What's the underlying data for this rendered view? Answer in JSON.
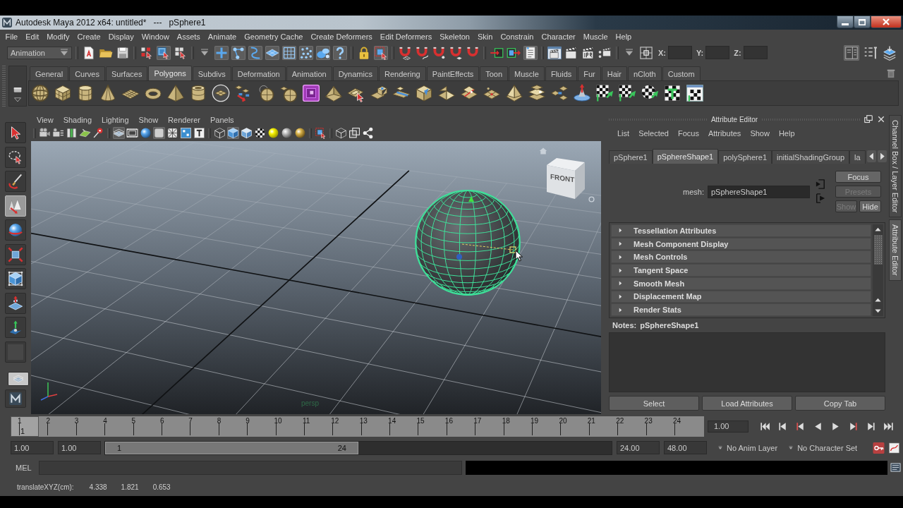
{
  "window": {
    "title": "Autodesk Maya 2012 x64: untitled*   ---   pSphere1"
  },
  "menu_bar": [
    "File",
    "Edit",
    "Modify",
    "Create",
    "Display",
    "Window",
    "Assets",
    "Animate",
    "Geometry Cache",
    "Create Deformers",
    "Edit Deformers",
    "Skeleton",
    "Skin",
    "Constrain",
    "Character",
    "Muscle",
    "Help"
  ],
  "status_line": {
    "menu_set": "Animation",
    "groups": [
      [
        {
          "kind": "new-file",
          "on": false
        },
        {
          "kind": "folder",
          "on": false
        },
        {
          "kind": "save",
          "on": false
        }
      ],
      [
        {
          "kind": "squares-cursor",
          "on": false
        },
        {
          "kind": "cube-cursor",
          "on": true
        },
        {
          "kind": "grid-cursor",
          "on": false
        }
      ],
      [
        {
          "kind": "caret",
          "on": false
        },
        {
          "kind": "plus",
          "on": true
        },
        {
          "kind": "curve-points",
          "on": true
        },
        {
          "kind": "curve",
          "on": true
        },
        {
          "kind": "plane-tile",
          "on": true
        },
        {
          "kind": "frame",
          "on": true
        },
        {
          "kind": "dots",
          "on": true
        },
        {
          "kind": "particles",
          "on": true
        },
        {
          "kind": "question-mark",
          "on": true
        }
      ],
      [
        {
          "kind": "lock",
          "on": false
        },
        {
          "kind": "select-box",
          "on": true
        }
      ],
      [
        {
          "kind": "magnet-grid",
          "on": false
        },
        {
          "kind": "magnet-curve",
          "on": false
        },
        {
          "kind": "magnet-point",
          "on": false
        },
        {
          "kind": "magnet-plane",
          "on": false
        },
        {
          "kind": "magnet",
          "on": false
        }
      ],
      [
        {
          "kind": "input-arrow",
          "on": false
        },
        {
          "kind": "output-arrow",
          "on": false
        },
        {
          "kind": "notes",
          "on": true
        }
      ],
      [
        {
          "kind": "clapper-window",
          "on": false
        },
        {
          "kind": "clapper",
          "on": false
        },
        {
          "kind": "clapper-ipr",
          "on": false
        },
        {
          "kind": "clapper-dots",
          "on": false
        }
      ],
      [
        {
          "kind": "caret",
          "on": false
        },
        {
          "kind": "target-frame",
          "on": false
        }
      ]
    ],
    "fields": [
      "X:",
      "Y:",
      "Z:"
    ],
    "panel_toggles": [
      {
        "kind": "panel",
        "on": true
      },
      {
        "kind": "list-wrench",
        "on": false
      },
      {
        "kind": "layers",
        "on": false
      }
    ]
  },
  "shelf": {
    "tabs": [
      {
        "label": "General",
        "selected": false
      },
      {
        "label": "Curves",
        "selected": false
      },
      {
        "label": "Surfaces",
        "selected": false
      },
      {
        "label": "Polygons",
        "selected": true
      },
      {
        "label": "Subdivs",
        "selected": false
      },
      {
        "label": "Deformation",
        "selected": false
      },
      {
        "label": "Animation",
        "selected": false
      },
      {
        "label": "Dynamics",
        "selected": false
      },
      {
        "label": "Rendering",
        "selected": false
      },
      {
        "label": "PaintEffects",
        "selected": false
      },
      {
        "label": "Toon",
        "selected": false
      },
      {
        "label": "Muscle",
        "selected": false
      },
      {
        "label": "Fluids",
        "selected": false
      },
      {
        "label": "Fur",
        "selected": false
      },
      {
        "label": "Hair",
        "selected": false
      },
      {
        "label": "nCloth",
        "selected": false
      },
      {
        "label": "Custom",
        "selected": false
      }
    ]
  },
  "toolbox": [
    {
      "kind": "select-arrow",
      "selected": false
    },
    {
      "kind": "lasso",
      "selected": false
    },
    {
      "kind": "paint-brush",
      "selected": false
    },
    {
      "kind": "move-tool",
      "selected": true
    },
    {
      "kind": "rotate-tool",
      "selected": false
    },
    {
      "kind": "scale-tool",
      "selected": false
    },
    {
      "kind": "universal-manip",
      "selected": false
    },
    {
      "kind": "soft-mod",
      "selected": false
    },
    {
      "kind": "show-manip",
      "selected": false
    },
    {
      "kind": "tool-slot",
      "selected": false
    }
  ],
  "viewport": {
    "menu": [
      "View",
      "Shading",
      "Lighting",
      "Show",
      "Renderer",
      "Panels"
    ],
    "toolbar": [
      [
        {
          "kind": "camera",
          "on": false
        },
        {
          "kind": "camera-reel",
          "on": false
        },
        {
          "kind": "bookmark",
          "on": false
        },
        {
          "kind": "image-plane",
          "on": false
        },
        {
          "kind": "cursor-pin",
          "on": false
        }
      ],
      [
        {
          "kind": "stacked-plane",
          "on": true
        },
        {
          "kind": "film-gate",
          "on": false
        },
        {
          "kind": "ball",
          "on": false
        },
        {
          "kind": "square",
          "on": true
        },
        {
          "kind": "crosshatch",
          "on": false
        },
        {
          "kind": "grid-dots",
          "on": false
        },
        {
          "kind": "t-box",
          "on": false
        }
      ],
      [
        {
          "kind": "wire-cube",
          "on": false
        },
        {
          "kind": "shaded-cube",
          "on": true
        },
        {
          "kind": "cube-outline",
          "on": false
        },
        {
          "kind": "checker-ball",
          "on": false
        },
        {
          "kind": "light-ball",
          "on": false
        },
        {
          "kind": "matte-ball",
          "on": false
        },
        {
          "kind": "shiny-ball",
          "on": false
        }
      ],
      [
        {
          "kind": "select-box",
          "on": false
        }
      ],
      [
        {
          "kind": "wire-cube",
          "on": false
        },
        {
          "kind": "overlap-squares",
          "on": false
        },
        {
          "kind": "share-nodes",
          "on": false
        }
      ]
    ],
    "view_cube_label": "FRONT",
    "camera_label": "persp"
  },
  "attribute_editor": {
    "title": "Attribute Editor",
    "menu": [
      "List",
      "Selected",
      "Focus",
      "Attributes",
      "Show",
      "Help"
    ],
    "tabs": [
      {
        "label": "pSphere1",
        "selected": false
      },
      {
        "label": "pSphereShape1",
        "selected": true
      },
      {
        "label": "polySphere1",
        "selected": false
      },
      {
        "label": "initialShadingGroup",
        "selected": false
      },
      {
        "label": "la",
        "selected": false
      }
    ],
    "node_label": "mesh:",
    "node_name": "pSphereShape1",
    "buttons": [
      {
        "label": "Focus",
        "disabled": false
      },
      {
        "label": "Presets",
        "disabled": true
      },
      {
        "label": "Show",
        "disabled": true
      },
      {
        "label": "Hide",
        "disabled": false
      }
    ],
    "sections": [
      {
        "label": "Tessellation Attributes",
        "expanded": false
      },
      {
        "label": "Mesh Component Display",
        "expanded": false
      },
      {
        "label": "Mesh Controls",
        "expanded": false
      },
      {
        "label": "Tangent Space",
        "expanded": false
      },
      {
        "label": "Smooth Mesh",
        "expanded": false
      },
      {
        "label": "Displacement Map",
        "expanded": false
      },
      {
        "label": "Render Stats",
        "expanded": false
      }
    ],
    "notes_label": "Notes:",
    "notes_node": "pSphereShape1",
    "bottom_buttons": [
      "Select",
      "Load Attributes",
      "Copy Tab"
    ]
  },
  "side_tabs": [
    {
      "label": "Channel Box / Layer Editor",
      "selected": false
    },
    {
      "label": "Attribute Editor",
      "selected": true
    }
  ],
  "time_slider": {
    "ticks": [
      {
        "label": "1",
        "selected": true
      },
      {
        "label": "2",
        "selected": false
      },
      {
        "label": "3",
        "selected": false
      },
      {
        "label": "4",
        "selected": false
      },
      {
        "label": "5",
        "selected": false
      },
      {
        "label": "6",
        "selected": false
      },
      {
        "label": "7",
        "selected": false
      },
      {
        "label": "8",
        "selected": false
      },
      {
        "label": "9",
        "selected": false
      },
      {
        "label": "10",
        "selected": false
      },
      {
        "label": "11",
        "selected": false
      },
      {
        "label": "12",
        "selected": false
      },
      {
        "label": "13",
        "selected": false
      },
      {
        "label": "14",
        "selected": false
      },
      {
        "label": "15",
        "selected": false
      },
      {
        "label": "16",
        "selected": false
      },
      {
        "label": "17",
        "selected": false
      },
      {
        "label": "18",
        "selected": false
      },
      {
        "label": "19",
        "selected": false
      },
      {
        "label": "20",
        "selected": false
      },
      {
        "label": "21",
        "selected": false
      },
      {
        "label": "22",
        "selected": false
      },
      {
        "label": "23",
        "selected": false
      },
      {
        "label": "24",
        "selected": false
      }
    ],
    "current_frame": "1",
    "current_time": "1.00"
  },
  "range_slider": {
    "start_time": "1.00",
    "range_start": "1.00",
    "range_min_label": "1",
    "range_max_label": "24",
    "level": 0.5,
    "range_end": "24.00",
    "end_time": "48.00",
    "anim_layer": "No Anim Layer",
    "character_set": "No Character Set"
  },
  "command_line": {
    "language": "MEL"
  },
  "help_line": {
    "label": "translateXYZ(cm):",
    "values": [
      "4.338",
      "1.821",
      "0.653"
    ]
  }
}
